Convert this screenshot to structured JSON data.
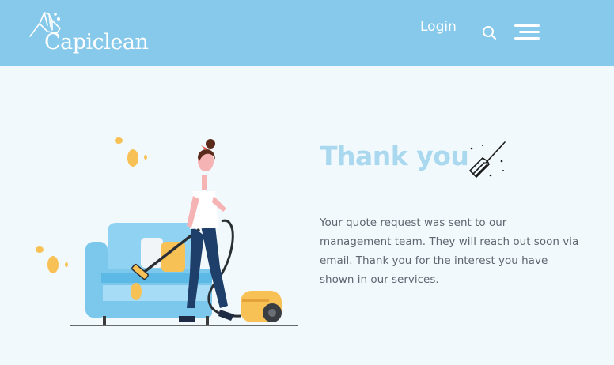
{
  "header": {
    "logo_text": "Capiclean",
    "login_label": "Login",
    "search_icon": "search-icon",
    "menu_icon": "hamburger-menu-icon",
    "background_color": "#87c9eb"
  },
  "main": {
    "title": "Thank you",
    "title_color": "#a9d8ef",
    "title_icon": "broom-icon",
    "message": "Your quote request was sent to our management team. They will reach out soon via email. Thank you for the interest you have shown in our services.",
    "illustration": "woman-vacuuming-sofa-illustration"
  }
}
